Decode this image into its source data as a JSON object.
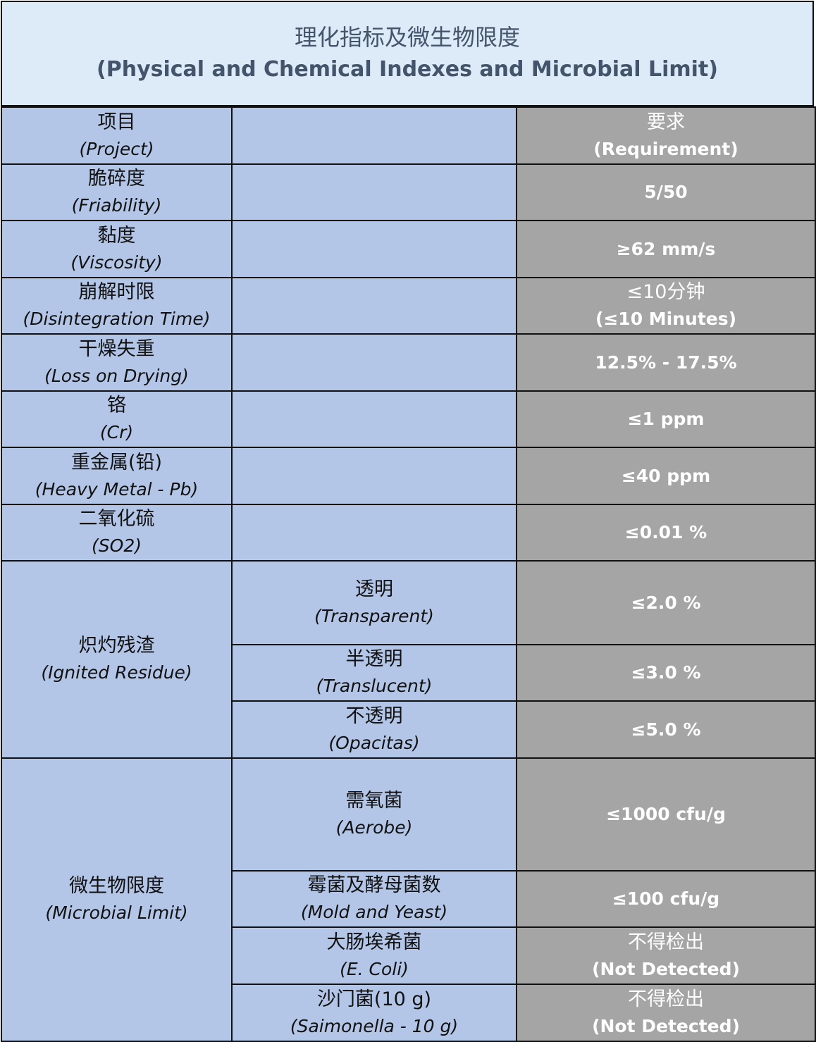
{
  "title": {
    "zh": "理化指标及微生物限度",
    "en": "(Physical and Chemical Indexes and Microbial Limit)"
  },
  "header": {
    "project_zh": "项目",
    "project_en": "(Project)",
    "req_zh": "要求",
    "req_en": "(Requirement)"
  },
  "rows": [
    {
      "zh": "脆碎度",
      "en": "(Friability)",
      "value": "5/50"
    },
    {
      "zh": "黏度",
      "en": "(Viscosity)",
      "value": "≥62 mm/s"
    },
    {
      "zh": "崩解时限",
      "en": "(Disintegration Time)",
      "value_zh": "≤10分钟",
      "value_en": "(≤10 Minutes)"
    },
    {
      "zh": "干燥失重",
      "en": "(Loss on Drying)",
      "value": "12.5% - 17.5%"
    },
    {
      "zh": "铬",
      "en": "(Cr)",
      "value": "≤1 ppm"
    },
    {
      "zh": "重金属(铅)",
      "en": "(Heavy Metal - Pb)",
      "value": "≤40 ppm"
    },
    {
      "zh": "二氧化硫",
      "en": "(SO2)",
      "value": "≤0.01 %"
    }
  ],
  "ignited_residue": {
    "zh": "炽灼残渣",
    "en": "(Ignited Residue)",
    "subs": [
      {
        "zh": "透明",
        "en": "(Transparent)",
        "value": "≤2.0 %"
      },
      {
        "zh": "半透明",
        "en": "(Translucent)",
        "value": "≤3.0 %"
      },
      {
        "zh": "不透明",
        "en": "(Opacitas)",
        "value": "≤5.0 %"
      }
    ]
  },
  "microbial_limit": {
    "zh": "微生物限度",
    "en": "(Microbial Limit)",
    "subs": [
      {
        "zh": "需氧菌",
        "en": "(Aerobe)",
        "value": "≤1000 cfu/g"
      },
      {
        "zh": "霉菌及酵母菌数",
        "en": "(Mold and Yeast)",
        "value": "≤100 cfu/g"
      },
      {
        "zh": "大肠埃希菌",
        "en": "(E. Coli)",
        "value_zh": "不得检出",
        "value_en": "(Not Detected)"
      },
      {
        "zh": "沙门菌(10 g)",
        "en": "(Saimonella - 10 g)",
        "value_zh": "不得检出",
        "value_en": "(Not Detected)"
      }
    ]
  }
}
